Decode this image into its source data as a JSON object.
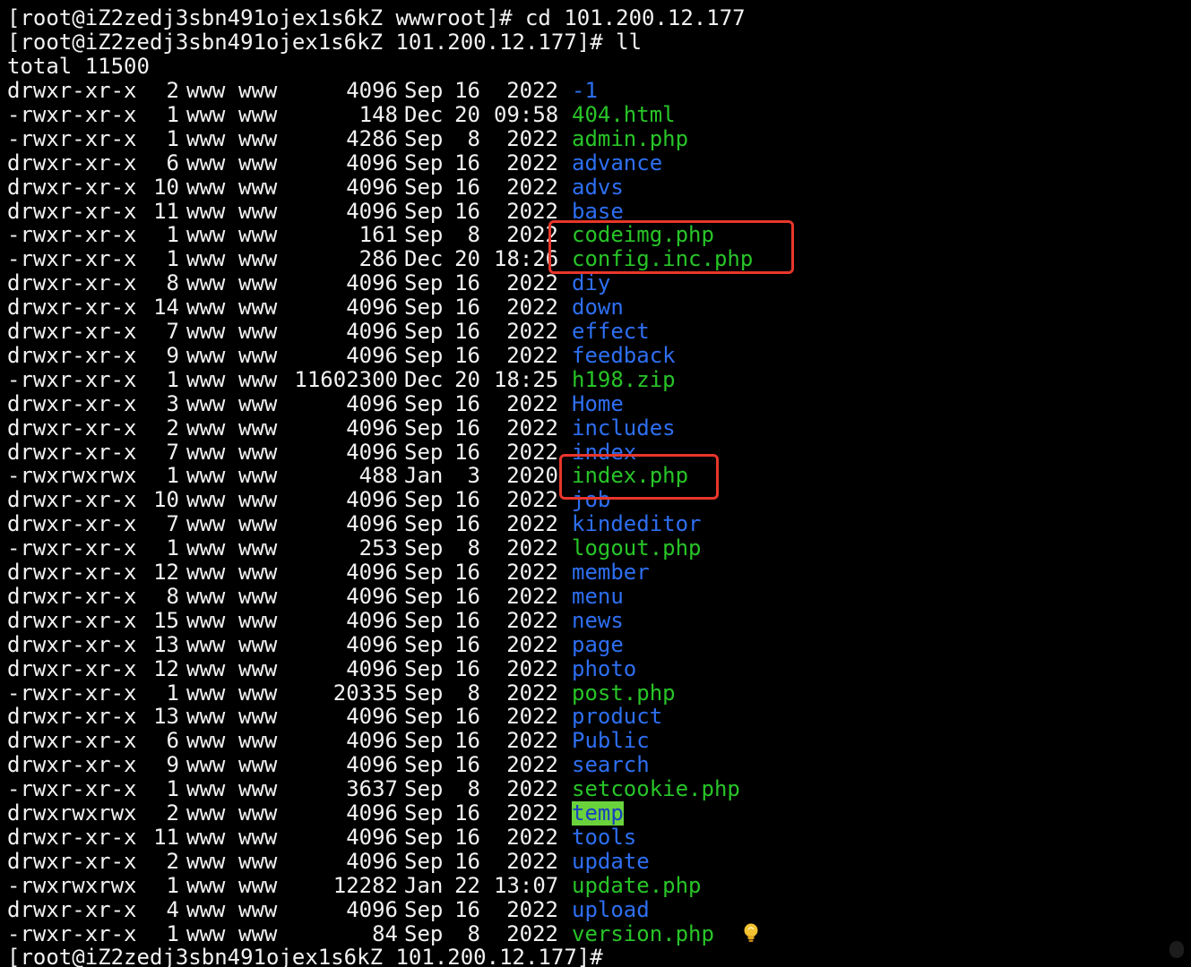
{
  "terminal": {
    "colors": {
      "background": "#000000",
      "text": "#f2f2f2",
      "directory": "#2e6ff2",
      "executable": "#28c528",
      "sticky_bg": "#6ad33c",
      "sticky_fg": "#1a3fbf",
      "highlight_box": "#e8362b"
    },
    "lines_top": [
      {
        "text": "[root@iZ2zedj3sbn491ojex1s6kZ wwwroot]# cd 101.200.12.177"
      },
      {
        "text": "[root@iZ2zedj3sbn491ojex1s6kZ 101.200.12.177]# ll"
      },
      {
        "text": "total 11500"
      }
    ],
    "listing": [
      {
        "perm": "drwxr-xr-x",
        "links": "2",
        "owner": "www",
        "group": "www",
        "size": "4096",
        "month": "Sep",
        "day": "16",
        "time": "2022",
        "name": "-1",
        "kind": "dir"
      },
      {
        "perm": "-rwxr-xr-x",
        "links": "1",
        "owner": "www",
        "group": "www",
        "size": "148",
        "month": "Dec",
        "day": "20",
        "time": "09:58",
        "name": "404.html",
        "kind": "exec"
      },
      {
        "perm": "-rwxr-xr-x",
        "links": "1",
        "owner": "www",
        "group": "www",
        "size": "4286",
        "month": "Sep",
        "day": "8",
        "time": "2022",
        "name": "admin.php",
        "kind": "exec"
      },
      {
        "perm": "drwxr-xr-x",
        "links": "6",
        "owner": "www",
        "group": "www",
        "size": "4096",
        "month": "Sep",
        "day": "16",
        "time": "2022",
        "name": "advance",
        "kind": "dir"
      },
      {
        "perm": "drwxr-xr-x",
        "links": "10",
        "owner": "www",
        "group": "www",
        "size": "4096",
        "month": "Sep",
        "day": "16",
        "time": "2022",
        "name": "advs",
        "kind": "dir"
      },
      {
        "perm": "drwxr-xr-x",
        "links": "11",
        "owner": "www",
        "group": "www",
        "size": "4096",
        "month": "Sep",
        "day": "16",
        "time": "2022",
        "name": "base",
        "kind": "dir"
      },
      {
        "perm": "-rwxr-xr-x",
        "links": "1",
        "owner": "www",
        "group": "www",
        "size": "161",
        "month": "Sep",
        "day": "8",
        "time": "2022",
        "name": "codeimg.php",
        "kind": "exec"
      },
      {
        "perm": "-rwxr-xr-x",
        "links": "1",
        "owner": "www",
        "group": "www",
        "size": "286",
        "month": "Dec",
        "day": "20",
        "time": "18:26",
        "name": "config.inc.php",
        "kind": "exec"
      },
      {
        "perm": "drwxr-xr-x",
        "links": "8",
        "owner": "www",
        "group": "www",
        "size": "4096",
        "month": "Sep",
        "day": "16",
        "time": "2022",
        "name": "diy",
        "kind": "dir"
      },
      {
        "perm": "drwxr-xr-x",
        "links": "14",
        "owner": "www",
        "group": "www",
        "size": "4096",
        "month": "Sep",
        "day": "16",
        "time": "2022",
        "name": "down",
        "kind": "dir"
      },
      {
        "perm": "drwxr-xr-x",
        "links": "7",
        "owner": "www",
        "group": "www",
        "size": "4096",
        "month": "Sep",
        "day": "16",
        "time": "2022",
        "name": "effect",
        "kind": "dir"
      },
      {
        "perm": "drwxr-xr-x",
        "links": "9",
        "owner": "www",
        "group": "www",
        "size": "4096",
        "month": "Sep",
        "day": "16",
        "time": "2022",
        "name": "feedback",
        "kind": "dir"
      },
      {
        "perm": "-rwxr-xr-x",
        "links": "1",
        "owner": "www",
        "group": "www",
        "size": "11602300",
        "month": "Dec",
        "day": "20",
        "time": "18:25",
        "name": "h198.zip",
        "kind": "exec"
      },
      {
        "perm": "drwxr-xr-x",
        "links": "3",
        "owner": "www",
        "group": "www",
        "size": "4096",
        "month": "Sep",
        "day": "16",
        "time": "2022",
        "name": "Home",
        "kind": "dir"
      },
      {
        "perm": "drwxr-xr-x",
        "links": "2",
        "owner": "www",
        "group": "www",
        "size": "4096",
        "month": "Sep",
        "day": "16",
        "time": "2022",
        "name": "includes",
        "kind": "dir"
      },
      {
        "perm": "drwxr-xr-x",
        "links": "7",
        "owner": "www",
        "group": "www",
        "size": "4096",
        "month": "Sep",
        "day": "16",
        "time": "2022",
        "name": "index",
        "kind": "dir"
      },
      {
        "perm": "-rwxrwxrwx",
        "links": "1",
        "owner": "www",
        "group": "www",
        "size": "488",
        "month": "Jan",
        "day": "3",
        "time": "2020",
        "name": "index.php",
        "kind": "exec"
      },
      {
        "perm": "drwxr-xr-x",
        "links": "10",
        "owner": "www",
        "group": "www",
        "size": "4096",
        "month": "Sep",
        "day": "16",
        "time": "2022",
        "name": "job",
        "kind": "dir"
      },
      {
        "perm": "drwxr-xr-x",
        "links": "7",
        "owner": "www",
        "group": "www",
        "size": "4096",
        "month": "Sep",
        "day": "16",
        "time": "2022",
        "name": "kindeditor",
        "kind": "dir"
      },
      {
        "perm": "-rwxr-xr-x",
        "links": "1",
        "owner": "www",
        "group": "www",
        "size": "253",
        "month": "Sep",
        "day": "8",
        "time": "2022",
        "name": "logout.php",
        "kind": "exec"
      },
      {
        "perm": "drwxr-xr-x",
        "links": "12",
        "owner": "www",
        "group": "www",
        "size": "4096",
        "month": "Sep",
        "day": "16",
        "time": "2022",
        "name": "member",
        "kind": "dir"
      },
      {
        "perm": "drwxr-xr-x",
        "links": "8",
        "owner": "www",
        "group": "www",
        "size": "4096",
        "month": "Sep",
        "day": "16",
        "time": "2022",
        "name": "menu",
        "kind": "dir"
      },
      {
        "perm": "drwxr-xr-x",
        "links": "15",
        "owner": "www",
        "group": "www",
        "size": "4096",
        "month": "Sep",
        "day": "16",
        "time": "2022",
        "name": "news",
        "kind": "dir"
      },
      {
        "perm": "drwxr-xr-x",
        "links": "13",
        "owner": "www",
        "group": "www",
        "size": "4096",
        "month": "Sep",
        "day": "16",
        "time": "2022",
        "name": "page",
        "kind": "dir"
      },
      {
        "perm": "drwxr-xr-x",
        "links": "12",
        "owner": "www",
        "group": "www",
        "size": "4096",
        "month": "Sep",
        "day": "16",
        "time": "2022",
        "name": "photo",
        "kind": "dir"
      },
      {
        "perm": "-rwxr-xr-x",
        "links": "1",
        "owner": "www",
        "group": "www",
        "size": "20335",
        "month": "Sep",
        "day": "8",
        "time": "2022",
        "name": "post.php",
        "kind": "exec"
      },
      {
        "perm": "drwxr-xr-x",
        "links": "13",
        "owner": "www",
        "group": "www",
        "size": "4096",
        "month": "Sep",
        "day": "16",
        "time": "2022",
        "name": "product",
        "kind": "dir"
      },
      {
        "perm": "drwxr-xr-x",
        "links": "6",
        "owner": "www",
        "group": "www",
        "size": "4096",
        "month": "Sep",
        "day": "16",
        "time": "2022",
        "name": "Public",
        "kind": "dir"
      },
      {
        "perm": "drwxr-xr-x",
        "links": "9",
        "owner": "www",
        "group": "www",
        "size": "4096",
        "month": "Sep",
        "day": "16",
        "time": "2022",
        "name": "search",
        "kind": "dir"
      },
      {
        "perm": "-rwxr-xr-x",
        "links": "1",
        "owner": "www",
        "group": "www",
        "size": "3637",
        "month": "Sep",
        "day": "8",
        "time": "2022",
        "name": "setcookie.php",
        "kind": "exec"
      },
      {
        "perm": "drwxrwxrwx",
        "links": "2",
        "owner": "www",
        "group": "www",
        "size": "4096",
        "month": "Sep",
        "day": "16",
        "time": "2022",
        "name": "temp",
        "kind": "sticky"
      },
      {
        "perm": "drwxr-xr-x",
        "links": "11",
        "owner": "www",
        "group": "www",
        "size": "4096",
        "month": "Sep",
        "day": "16",
        "time": "2022",
        "name": "tools",
        "kind": "dir"
      },
      {
        "perm": "drwxr-xr-x",
        "links": "2",
        "owner": "www",
        "group": "www",
        "size": "4096",
        "month": "Sep",
        "day": "16",
        "time": "2022",
        "name": "update",
        "kind": "dir"
      },
      {
        "perm": "-rwxrwxrwx",
        "links": "1",
        "owner": "www",
        "group": "www",
        "size": "12282",
        "month": "Jan",
        "day": "22",
        "time": "13:07",
        "name": "update.php",
        "kind": "exec"
      },
      {
        "perm": "drwxr-xr-x",
        "links": "4",
        "owner": "www",
        "group": "www",
        "size": "4096",
        "month": "Sep",
        "day": "16",
        "time": "2022",
        "name": "upload",
        "kind": "dir"
      },
      {
        "perm": "-rwxr-xr-x",
        "links": "1",
        "owner": "www",
        "group": "www",
        "size": "84",
        "month": "Sep",
        "day": "8",
        "time": "2022",
        "name": "version.php",
        "kind": "exec"
      }
    ],
    "final_prompt": "[root@iZ2zedj3sbn491ojex1s6kZ 101.200.12.177]#",
    "icons": {
      "bulb": "lightbulb-icon"
    }
  }
}
